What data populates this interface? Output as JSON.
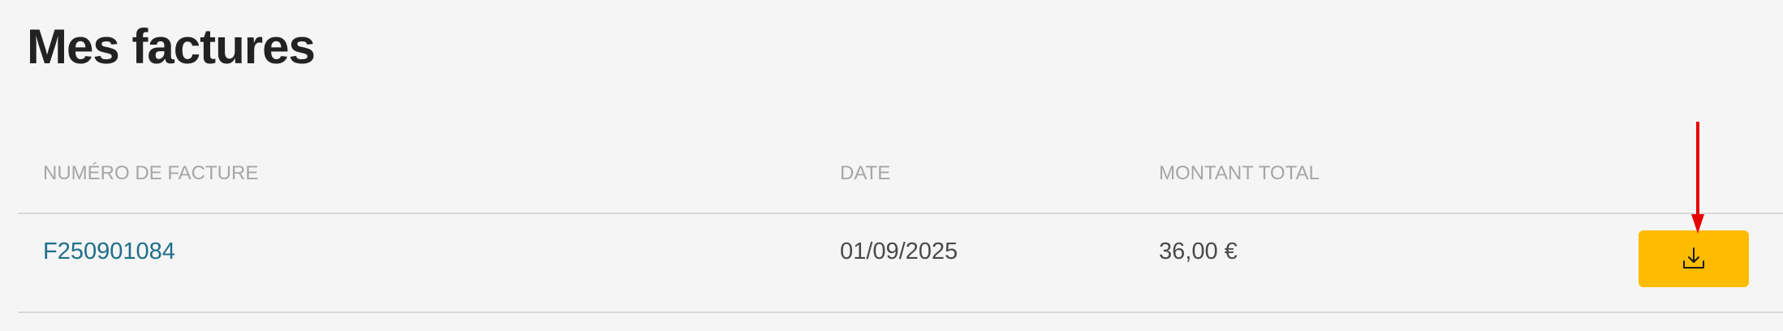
{
  "page": {
    "title": "Mes factures"
  },
  "table": {
    "headers": {
      "number": "NUMÉRO DE FACTURE",
      "date": "DATE",
      "amount": "MONTANT TOTAL"
    },
    "rows": [
      {
        "number": "F250901084",
        "date": "01/09/2025",
        "amount": "36,00 €",
        "action_icon": "download-icon"
      }
    ]
  },
  "colors": {
    "accent": "#ffbb00",
    "link": "#1f6f8b",
    "annotation": "#e60000"
  }
}
